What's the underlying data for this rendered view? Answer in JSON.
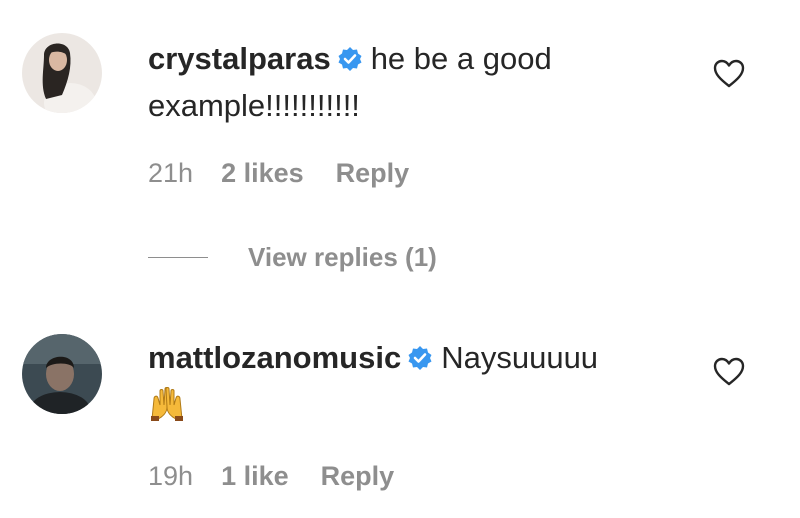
{
  "comments": [
    {
      "username": "crystalparas",
      "verified": true,
      "text": "he be a good example!!!!!!!!!!!",
      "time": "21h",
      "likes": "2 likes",
      "reply_label": "Reply",
      "avatar_icon": "avatar-woman-icon"
    },
    {
      "username": "mattlozanomusic",
      "verified": true,
      "text": "Naysuuuuu",
      "emoji": "raising-hands-emoji",
      "time": "19h",
      "likes": "1 like",
      "reply_label": "Reply",
      "avatar_icon": "avatar-man-icon"
    }
  ],
  "view_replies": "View replies (1)",
  "colors": {
    "text": "#262626",
    "muted": "#8e8e8e",
    "verified": "#3897f0"
  }
}
